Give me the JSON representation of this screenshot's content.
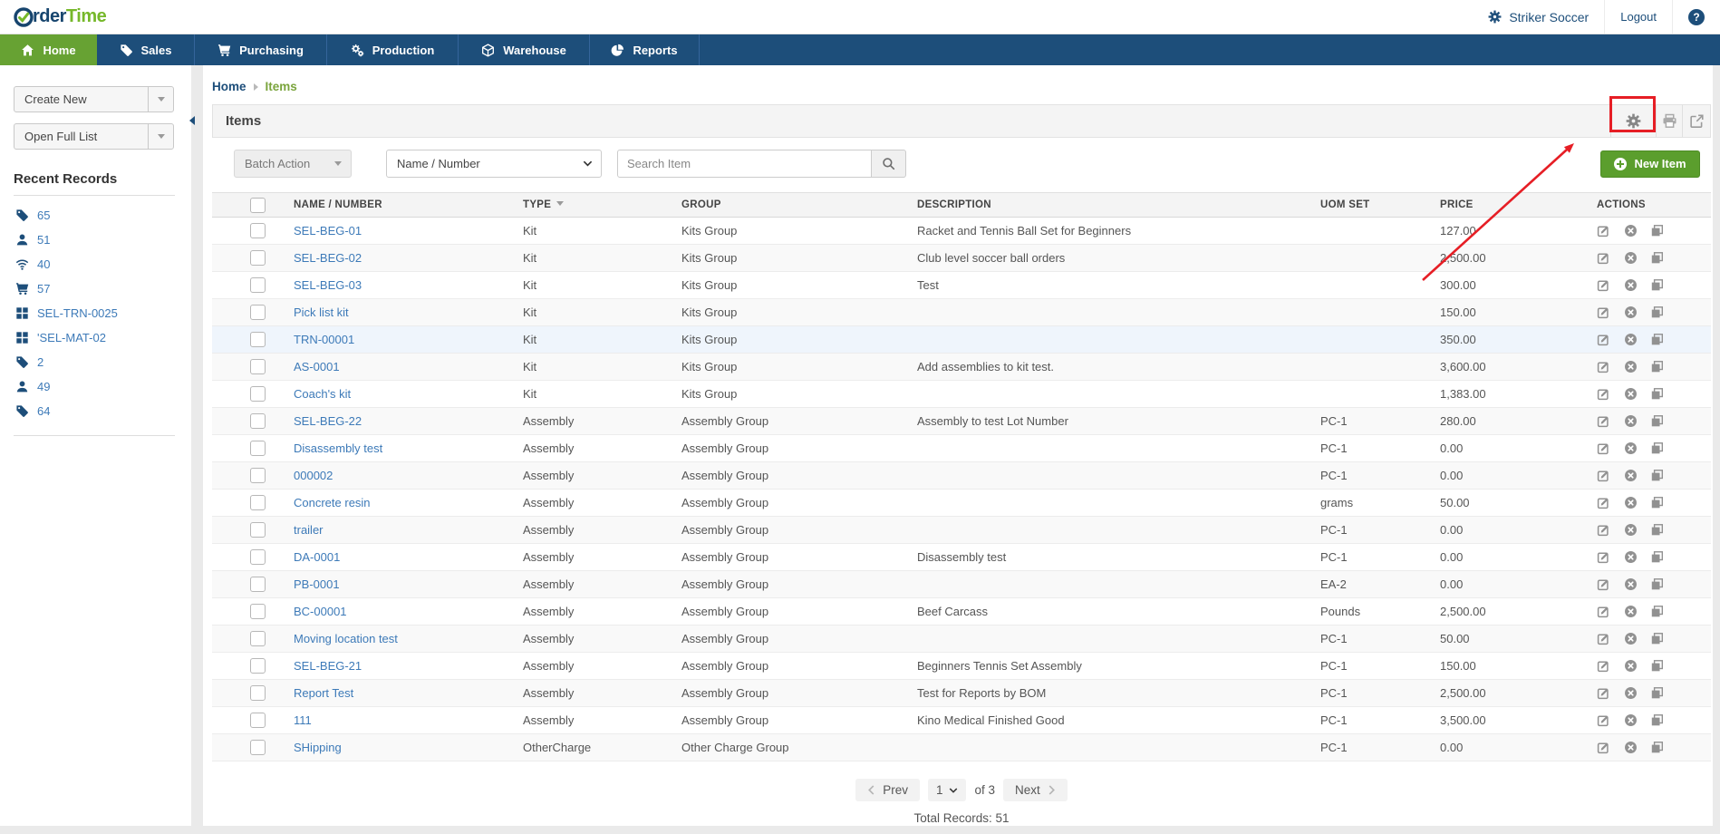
{
  "brand": {
    "logo_order": "rder",
    "logo_time": "Time"
  },
  "topbar": {
    "company": "Striker Soccer",
    "logout": "Logout",
    "help_glyph": "?"
  },
  "nav": {
    "items": [
      {
        "label": "Home",
        "icon": "home-icon",
        "active": true
      },
      {
        "label": "Sales",
        "icon": "tags-icon",
        "active": false
      },
      {
        "label": "Purchasing",
        "icon": "cart-icon",
        "active": false
      },
      {
        "label": "Production",
        "icon": "gears-icon",
        "active": false
      },
      {
        "label": "Warehouse",
        "icon": "cube-icon",
        "active": false
      },
      {
        "label": "Reports",
        "icon": "pie-chart-icon",
        "active": false
      }
    ]
  },
  "sidebar": {
    "create_new_label": "Create New",
    "open_full_list_label": "Open Full List",
    "recent_title": "Recent Records",
    "records": [
      {
        "icon": "tags-icon",
        "label": "65"
      },
      {
        "icon": "user-icon",
        "label": "51"
      },
      {
        "icon": "wifi-icon",
        "label": "40"
      },
      {
        "icon": "cart-icon",
        "label": "57"
      },
      {
        "icon": "grid-icon",
        "label": "SEL-TRN-0025"
      },
      {
        "icon": "grid-icon",
        "label": "'SEL-MAT-02"
      },
      {
        "icon": "tags-icon",
        "label": "2"
      },
      {
        "icon": "user-icon",
        "label": "49"
      },
      {
        "icon": "tags-icon",
        "label": "64"
      }
    ]
  },
  "breadcrumb": {
    "home": "Home",
    "current": "Items"
  },
  "panel": {
    "title": "Items"
  },
  "filters": {
    "batch_action_label": "Batch Action",
    "field_selected": "Name / Number",
    "search_placeholder": "Search Item",
    "new_item_label": "New Item"
  },
  "table": {
    "headers": {
      "name": "NAME / NUMBER",
      "type": "TYPE",
      "group": "GROUP",
      "description": "DESCRIPTION",
      "uom": "UOM SET",
      "price": "PRICE",
      "actions": "ACTIONS"
    },
    "rows": [
      {
        "name": "SEL-BEG-01",
        "type": "Kit",
        "group": "Kits Group",
        "description": "Racket and Tennis Ball Set for Beginners",
        "uom": "",
        "price": "127.00"
      },
      {
        "name": "SEL-BEG-02",
        "type": "Kit",
        "group": "Kits Group",
        "description": "Club level soccer ball orders",
        "uom": "",
        "price": "2,500.00"
      },
      {
        "name": "SEL-BEG-03",
        "type": "Kit",
        "group": "Kits Group",
        "description": "Test",
        "uom": "",
        "price": "300.00"
      },
      {
        "name": "Pick list kit",
        "type": "Kit",
        "group": "Kits Group",
        "description": "",
        "uom": "",
        "price": "150.00"
      },
      {
        "name": "TRN-00001",
        "type": "Kit",
        "group": "Kits Group",
        "description": "",
        "uom": "",
        "price": "350.00",
        "highlighted": true
      },
      {
        "name": "AS-0001",
        "type": "Kit",
        "group": "Kits Group",
        "description": "Add assemblies to kit test.",
        "uom": "",
        "price": "3,600.00"
      },
      {
        "name": "Coach's kit",
        "type": "Kit",
        "group": "Kits Group",
        "description": "",
        "uom": "",
        "price": "1,383.00"
      },
      {
        "name": "SEL-BEG-22",
        "type": "Assembly",
        "group": "Assembly Group",
        "description": "Assembly to test Lot Number",
        "uom": "PC-1",
        "price": "280.00"
      },
      {
        "name": "Disassembly test",
        "type": "Assembly",
        "group": "Assembly Group",
        "description": "",
        "uom": "PC-1",
        "price": "0.00"
      },
      {
        "name": "000002",
        "type": "Assembly",
        "group": "Assembly Group",
        "description": "",
        "uom": "PC-1",
        "price": "0.00"
      },
      {
        "name": "Concrete resin",
        "type": "Assembly",
        "group": "Assembly Group",
        "description": "",
        "uom": "grams",
        "price": "50.00"
      },
      {
        "name": "trailer",
        "type": "Assembly",
        "group": "Assembly Group",
        "description": "",
        "uom": "PC-1",
        "price": "0.00"
      },
      {
        "name": "DA-0001",
        "type": "Assembly",
        "group": "Assembly Group",
        "description": "Disassembly test",
        "uom": "PC-1",
        "price": "0.00"
      },
      {
        "name": "PB-0001",
        "type": "Assembly",
        "group": "Assembly Group",
        "description": "",
        "uom": "EA-2",
        "price": "0.00"
      },
      {
        "name": "BC-00001",
        "type": "Assembly",
        "group": "Assembly Group",
        "description": "Beef Carcass",
        "uom": "Pounds",
        "price": "2,500.00"
      },
      {
        "name": "Moving location test",
        "type": "Assembly",
        "group": "Assembly Group",
        "description": "",
        "uom": "PC-1",
        "price": "50.00"
      },
      {
        "name": "SEL-BEG-21",
        "type": "Assembly",
        "group": "Assembly Group",
        "description": "Beginners Tennis Set Assembly",
        "uom": "PC-1",
        "price": "150.00"
      },
      {
        "name": "Report Test",
        "type": "Assembly",
        "group": "Assembly Group",
        "description": "Test for Reports by BOM",
        "uom": "PC-1",
        "price": "2,500.00"
      },
      {
        "name": "111",
        "type": "Assembly",
        "group": "Assembly Group",
        "description": "Kino Medical Finished Good",
        "uom": "PC-1",
        "price": "3,500.00"
      },
      {
        "name": "SHipping",
        "type": "OtherCharge",
        "group": "Other Charge Group",
        "description": "",
        "uom": "PC-1",
        "price": "0.00"
      }
    ]
  },
  "pagination": {
    "prev_label": "Prev",
    "page": "1",
    "of_label": "of 3",
    "next_label": "Next",
    "total": "Total Records: 51"
  },
  "colors": {
    "nav_blue": "#1d4e7a",
    "active_green": "#67a233",
    "logo_green": "#76b82a",
    "button_green": "#5b9e2d",
    "link_blue": "#3d7ab8",
    "annotation_red": "#e61e25"
  }
}
